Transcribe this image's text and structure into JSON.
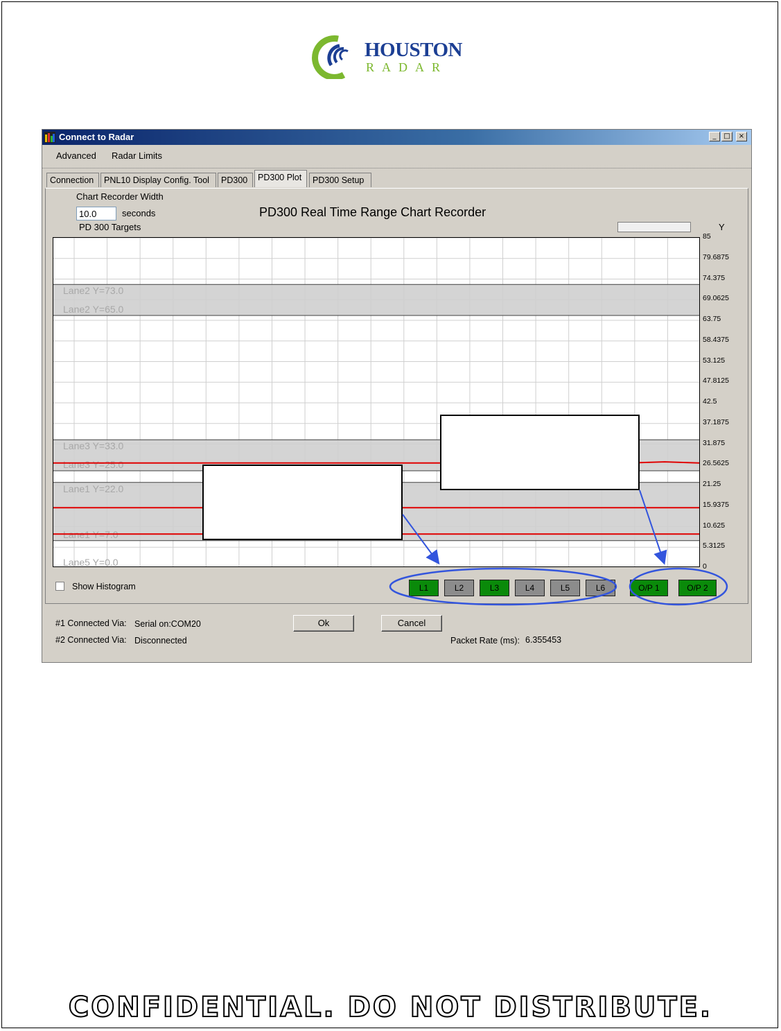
{
  "logo": {
    "word1": "HOUSTON",
    "word2": "RADAR"
  },
  "window": {
    "title": "Connect to Radar",
    "minimize": "_",
    "maximize": "□",
    "close": "×"
  },
  "menu": {
    "items": [
      "Advanced",
      "Radar Limits"
    ]
  },
  "tabs": [
    "Connection",
    "PNL10 Display Config. Tool",
    "PD300",
    "PD300 Plot",
    "PD300 Setup"
  ],
  "active_tab": "PD300 Plot",
  "controls": {
    "width_label": "Chart Recorder Width",
    "width_value": "10.0",
    "width_unit": "seconds",
    "targets_label": "PD 300 Targets",
    "chart_title": "PD300 Real Time Range Chart Recorder",
    "y_axis_label": "Y",
    "show_histogram": "Show Histogram"
  },
  "chart_data": {
    "type": "line",
    "title": "PD300 Real Time Range Chart Recorder",
    "ylabel": "Y",
    "ylim": [
      0,
      85
    ],
    "y_ticks": [
      "85",
      "79.6875",
      "74.375",
      "69.0625",
      "63.75",
      "58.4375",
      "53.125",
      "47.8125",
      "42.5",
      "37.1875",
      "31.875",
      "26.5625",
      "21.25",
      "15.9375",
      "10.625",
      "5.3125",
      "0"
    ],
    "lanes": [
      {
        "name": "Lane2",
        "top": 73.0,
        "bottom": 65.0,
        "labels": [
          "Lane2 Y=73.0",
          "Lane2 Y=65.0"
        ]
      },
      {
        "name": "Lane3",
        "top": 33.0,
        "bottom": 25.0,
        "labels": [
          "Lane3 Y=33.0",
          "Lane3 Y=25.0"
        ]
      },
      {
        "name": "Lane1",
        "top": 22.0,
        "bottom": 7.0,
        "labels": [
          "Lane1 Y=22.0",
          "Lane1 Y=7.0"
        ]
      },
      {
        "name": "Lane5",
        "top": 0.0,
        "bottom": 0.0,
        "labels": [
          "Lane5 Y=0.0"
        ]
      }
    ],
    "series": [
      {
        "values": [
          27.0,
          27.0,
          27.0,
          27.0,
          27.0,
          27.0,
          27.0,
          27.0,
          27.0,
          27.0,
          27.0,
          27.0,
          27.0,
          27.0,
          27.0,
          27.0,
          27.0,
          27.3,
          27.0
        ]
      },
      {
        "values": [
          15.5,
          15.5
        ]
      },
      {
        "values": [
          8.7,
          8.7
        ]
      }
    ],
    "grid": true
  },
  "lane_buttons": [
    {
      "label": "L1",
      "state": "on"
    },
    {
      "label": "L2",
      "state": "off"
    },
    {
      "label": "L3",
      "state": "on"
    },
    {
      "label": "L4",
      "state": "off"
    },
    {
      "label": "L5",
      "state": "off"
    },
    {
      "label": "L6",
      "state": "off"
    }
  ],
  "output_buttons": [
    {
      "label": "O/P 1",
      "state": "on"
    },
    {
      "label": "O/P 2",
      "state": "on"
    }
  ],
  "status": {
    "conn1_label": "#1 Connected Via:",
    "conn1_value": "Serial on:COM20",
    "conn2_label": "#2 Connected Via:",
    "conn2_value": "Disconnected",
    "packet_label": "Packet Rate (ms):",
    "packet_value": "6.355453"
  },
  "buttons": {
    "ok": "Ok",
    "cancel": "Cancel"
  },
  "colors": {
    "on": "#0a8a0a",
    "off": "#8c8c8c",
    "trace": "#e00000",
    "lane": "#d4d4d4",
    "annotation": "#3355dd"
  },
  "footer": "CONFIDENTIAL. DO NOT DISTRIBUTE."
}
